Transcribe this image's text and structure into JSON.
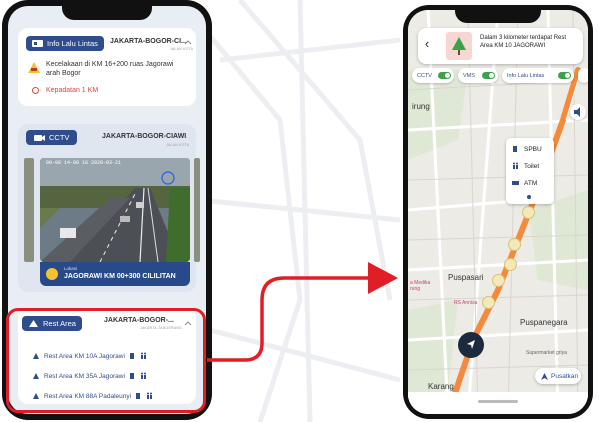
{
  "left_phone": {
    "info_card": {
      "chip_label": "Info Lalu Lintas",
      "road": "JAKARTA-BOGOR-CI...",
      "sub": "JALAN KOTA",
      "incident": "Kecelakaan di KM 16+200 ruas Jagorawi arah Bogor",
      "density": "Kepadatan 1 KM"
    },
    "cctv_card": {
      "chip_label": "CCTV",
      "road": "JAKARTA-BOGOR-CIAWI",
      "sub": "JALAN KOTA",
      "timestamp": "00-00 14-08 18 2020-03-21",
      "location_label": "Lokasi",
      "location_name": "JAGORAWI KM 00+300 CILILITAN"
    },
    "rest_card": {
      "chip_label": "Rest Area",
      "road": "JAKARTA-BOGOR-...",
      "sub": "JAKARTA-TANGERANG",
      "items": [
        {
          "label": "Rest Area KM 10A Jagorawi"
        },
        {
          "label": "Rest Area KM 35A Jagorawi"
        },
        {
          "label": "Rest Area KM 88A Padaleunyi"
        }
      ]
    }
  },
  "right_phone": {
    "banner_text": "Dalam 3 kilometer terdapat Rest Area KM 10 JAGORAWI",
    "toggles": {
      "cctv": "CCTV",
      "vms": "VMS",
      "info": "Info Lalu Lintas"
    },
    "popup": {
      "spbu": "SPBU",
      "toilet": "Toilet",
      "atm": "ATM"
    },
    "map_labels": {
      "cirung": "irung",
      "puspasari": "Puspasari",
      "puspanegara": "Puspanegara",
      "karang": "Karang",
      "rs_annisa": "RS Annisa",
      "medika": "a Medika\nrung",
      "supermarket": "Supermarket griya"
    },
    "center_button": "Pusatkan"
  },
  "colors": {
    "brand_blue": "#2f4d8c",
    "highlight_red": "#e11e26",
    "toggle_green": "#3aa34a",
    "route_orange": "#f58a3c"
  }
}
